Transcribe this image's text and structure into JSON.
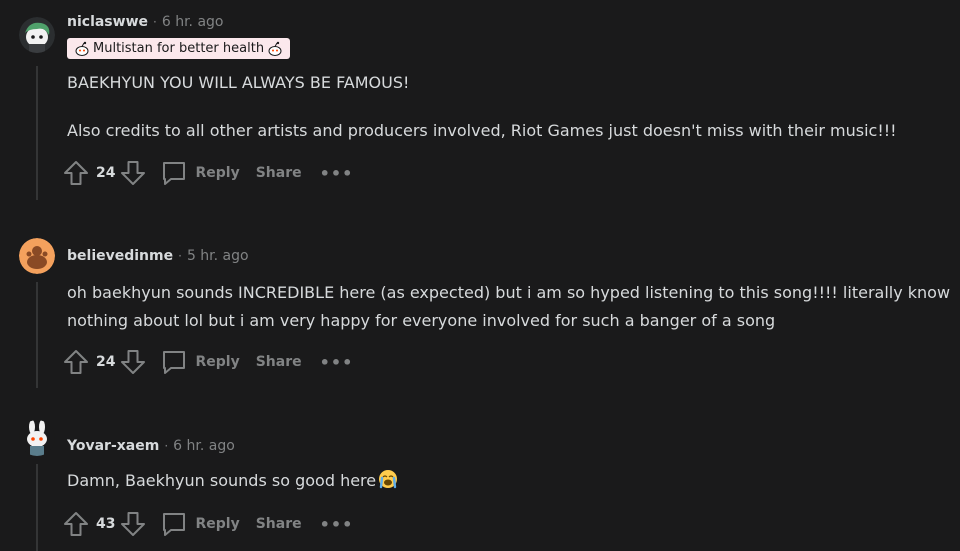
{
  "comments": [
    {
      "username": "niclaswwe",
      "separator": "·",
      "time": "6 hr. ago",
      "flair": "Multistan for better health",
      "body": [
        "BAEKHYUN YOU WILL ALWAYS BE FAMOUS!",
        "Also credits to all other artists and producers involved, Riot Games just doesn't miss with their music!!!"
      ],
      "score": "24",
      "reply_label": "Reply",
      "share_label": "Share",
      "more_label": "•••",
      "avatar_icon": "green-haired-snoo-avatar-icon"
    },
    {
      "username": "believedinme",
      "separator": "·",
      "time": "5 hr. ago",
      "body": [
        "oh baekhyun sounds INCREDIBLE here (as expected) but i am so hyped listening to this song!!!! literally know nothing about lol but i am very happy for everyone involved for such a banger of a song"
      ],
      "score": "24",
      "reply_label": "Reply",
      "share_label": "Share",
      "more_label": "•••",
      "avatar_icon": "default-orange-snoo-avatar-icon"
    },
    {
      "username": "Yovar-xaem",
      "separator": "·",
      "time": "6 hr. ago",
      "body": [
        "Damn, Baekhyun sounds so good here"
      ],
      "body_emoji": "loudly-crying-face-emoji",
      "score": "43",
      "reply_label": "Reply",
      "share_label": "Share",
      "more_label": "•••",
      "avatar_icon": "bunny-ears-snoo-avatar-icon"
    }
  ],
  "colors": {
    "background": "#1a1a1b",
    "text": "#d7dadc",
    "muted": "#818384",
    "thread_line": "#343536",
    "flair_bg": "#fbe8ec"
  }
}
